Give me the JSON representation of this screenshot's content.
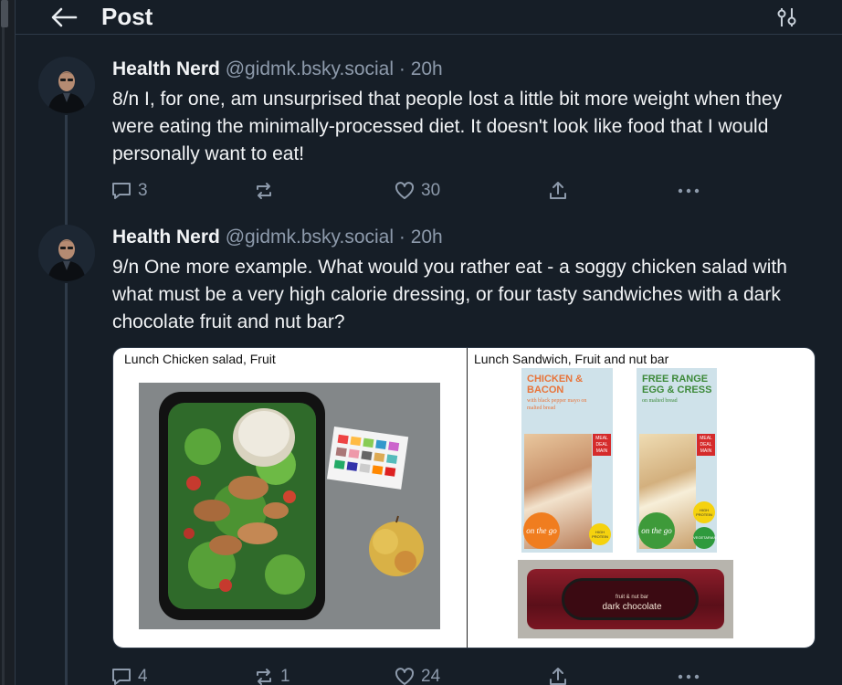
{
  "header": {
    "title": "Post"
  },
  "posts": [
    {
      "author": "Health Nerd",
      "handle": "@gidmk.bsky.social",
      "time": "· 20h",
      "text": "8/n I, for one, am unsurprised that people lost a little bit more weight when they were eating the minimally-processed diet. It doesn't look like food that I would personally want to eat!",
      "replies": "3",
      "reposts": "",
      "likes": "30"
    },
    {
      "author": "Health Nerd",
      "handle": "@gidmk.bsky.social",
      "time": "· 20h",
      "text": "9/n One more example. What would you rather eat - a soggy chicken salad with what must be a very high calorie dressing, or four tasty sandwiches with a dark chocolate fruit and nut bar?",
      "replies": "4",
      "reposts": "1",
      "likes": "24",
      "image": {
        "left_caption": "Lunch Chicken salad, Fruit",
        "right_caption": "Lunch Sandwich, Fruit and nut bar",
        "pack1_name": "CHICKEN & BACON",
        "pack1_sub": "with black pepper mayo on malted bread",
        "pack2_name": "FREE RANGE EGG & CRESS",
        "pack2_sub": "on malted bread",
        "meal_deal": "MEAL DEAL MAIN",
        "brand": "on the go",
        "badge_protein": "HIGH PROTEIN",
        "badge_veg": "VEGETARIAN",
        "bar_top": "fruit & nut bar",
        "bar_label": "dark chocolate"
      }
    }
  ]
}
